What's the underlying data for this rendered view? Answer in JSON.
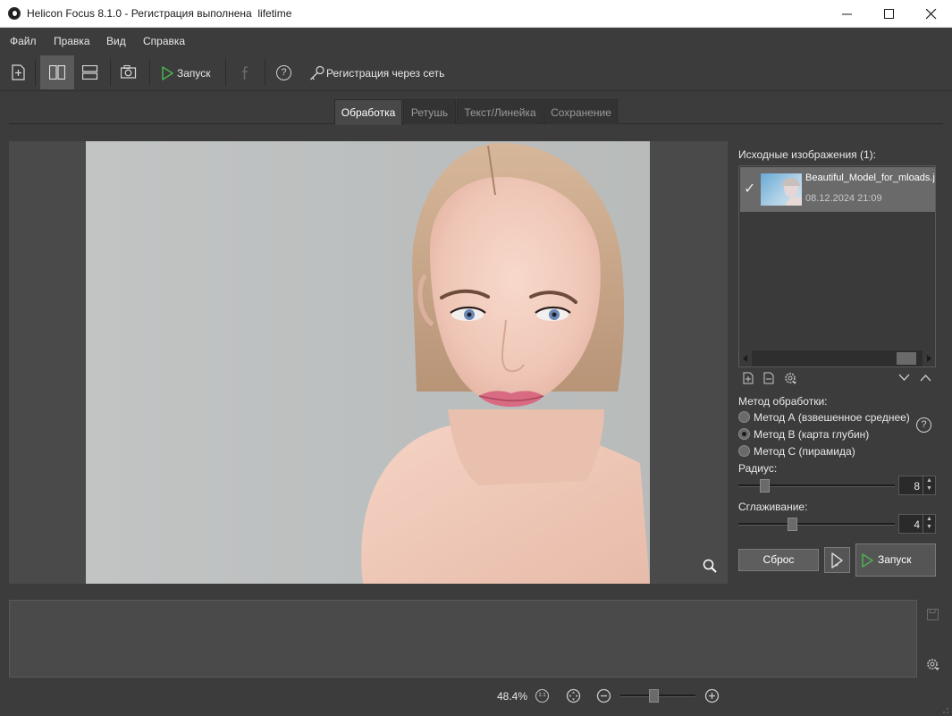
{
  "window": {
    "title": "Helicon Focus 8.1.0 - Регистрация выполнена  lifetime"
  },
  "menu": {
    "items": [
      "Файл",
      "Правка",
      "Вид",
      "Справка"
    ]
  },
  "toolbar": {
    "run_label": "Запуск",
    "register_label": "Регистрация через сеть",
    "help_label": "?"
  },
  "tabs": [
    "Обработка",
    "Ретушь",
    "Текст/Линейка",
    "Сохранение"
  ],
  "active_tab": "Обработка",
  "sources": {
    "header": "Исходные изображения (1):",
    "items": [
      {
        "checked": true,
        "name": "Beautiful_Model_for_mloads.jpg",
        "date": "08.12.2024 21:09"
      }
    ]
  },
  "method": {
    "label": "Метод обработки:",
    "options": [
      {
        "label": "Метод А (взвешенное среднее)",
        "selected": false
      },
      {
        "label": "Метод В (карта глубин)",
        "selected": true
      },
      {
        "label": "Метод С (пирамида)",
        "selected": false
      }
    ],
    "help": "?"
  },
  "radius": {
    "label": "Радиус:",
    "value": "8"
  },
  "smoothing": {
    "label": "Сглаживание:",
    "value": "4"
  },
  "actions": {
    "reset_label": "Сброс",
    "run_label": "Запуск"
  },
  "status": {
    "zoom": "48.4%",
    "one_to_one": "1:1"
  },
  "colors": {
    "background": "#3c3c3c",
    "panel": "#4a4a4a",
    "run_accent": "#4caf50",
    "titlebar": "#ffffff"
  },
  "icons": [
    "new-project-icon",
    "side-by-side-view-icon",
    "stacked-view-icon",
    "camera-icon",
    "play-icon",
    "facebook-icon",
    "help-icon",
    "key-icon",
    "magnifier-icon",
    "add-file-icon",
    "remove-file-icon",
    "settings-icon",
    "chevron-down-icon",
    "chevron-up-icon",
    "save-log-icon",
    "fit-icon",
    "zoom-out-icon",
    "zoom-in-icon"
  ]
}
